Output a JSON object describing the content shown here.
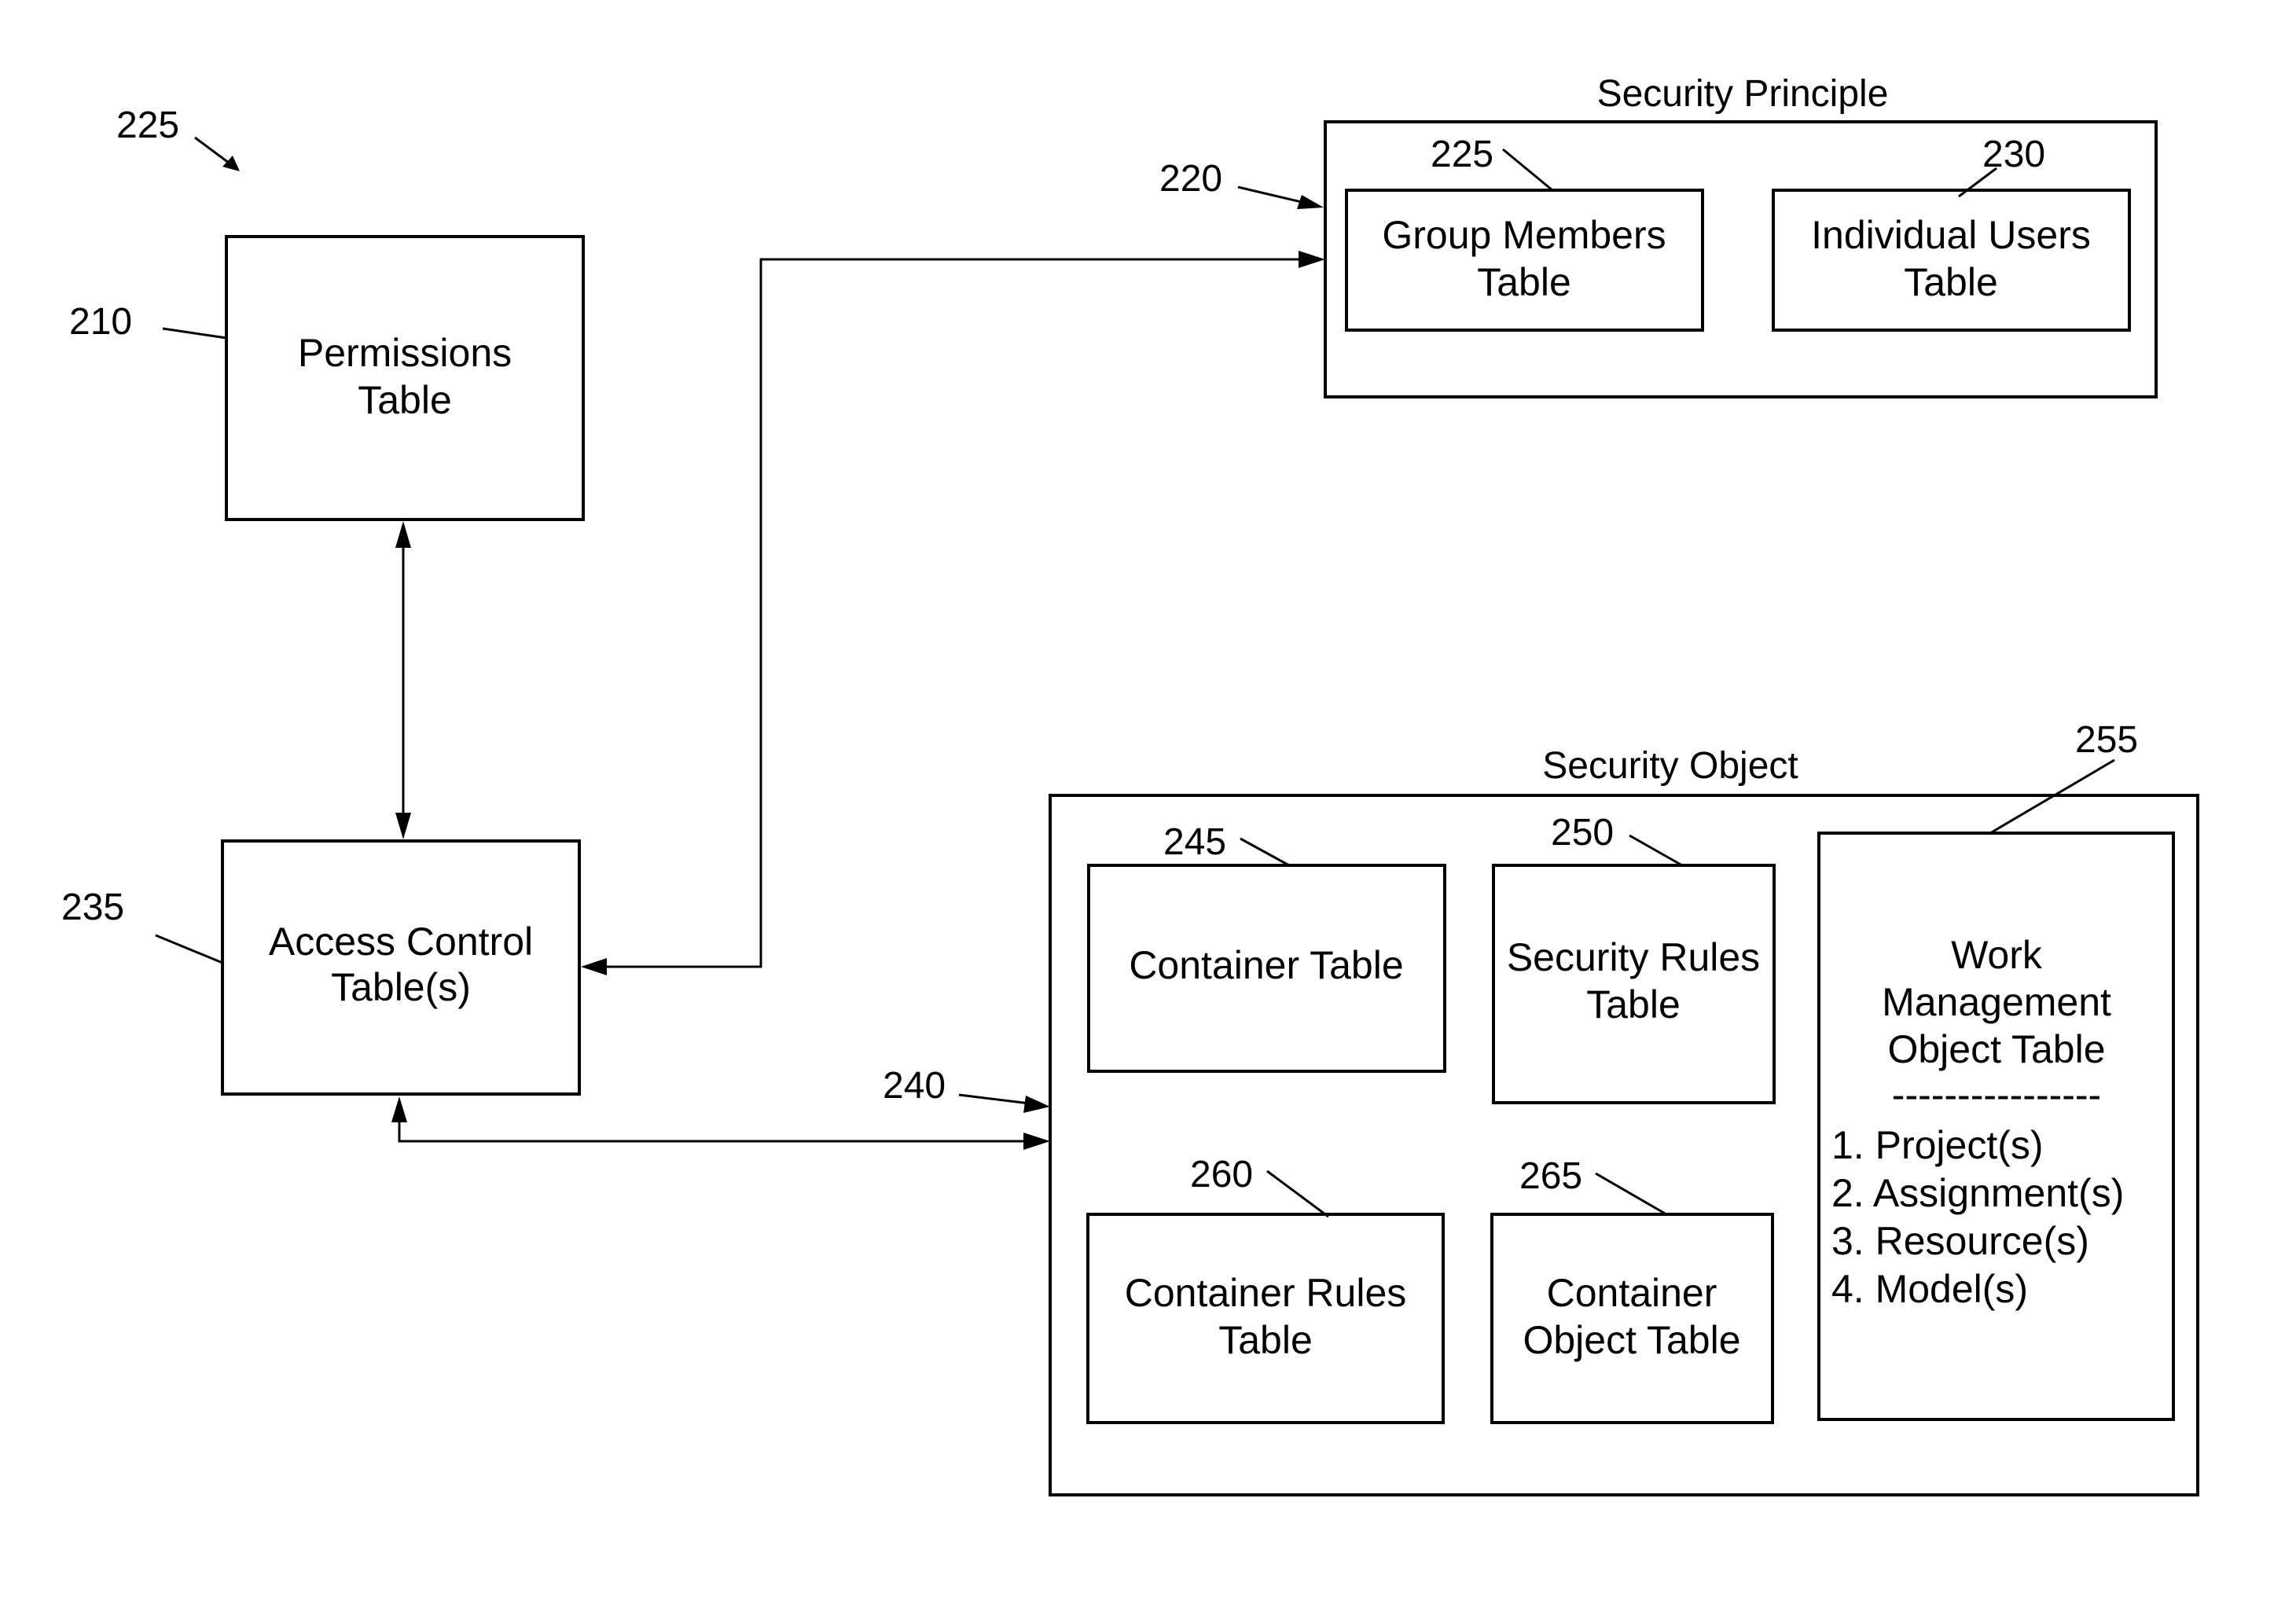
{
  "diagram": {
    "figure_ref": "225",
    "permissions": {
      "ref": "210",
      "lines": [
        "Permissions",
        "Table"
      ]
    },
    "access_control": {
      "ref": "235",
      "lines": [
        "Access Control",
        "Table(s)"
      ]
    },
    "security_principle": {
      "title": "Security Principle",
      "ref": "220",
      "group_members": {
        "ref": "225",
        "lines": [
          "Group Members",
          "Table"
        ]
      },
      "individual_users": {
        "ref": "230",
        "lines": [
          "Individual Users",
          "Table"
        ]
      }
    },
    "security_object": {
      "title": "Security Object",
      "ref": "240",
      "container_table": {
        "ref": "245",
        "lines": [
          "Container Table"
        ]
      },
      "security_rules": {
        "ref": "250",
        "lines": [
          "Security Rules",
          "Table"
        ]
      },
      "work_management": {
        "ref": "255",
        "lines": [
          "Work",
          "Management",
          "Object Table"
        ],
        "separator": "----------------",
        "items": [
          "1. Project(s)",
          "2. Assignment(s)",
          "3. Resource(s)",
          "4. Model(s)"
        ]
      },
      "container_rules": {
        "ref": "260",
        "lines": [
          "Container Rules",
          "Table"
        ]
      },
      "container_object": {
        "ref": "265",
        "lines": [
          "Container",
          "Object Table"
        ]
      }
    }
  }
}
